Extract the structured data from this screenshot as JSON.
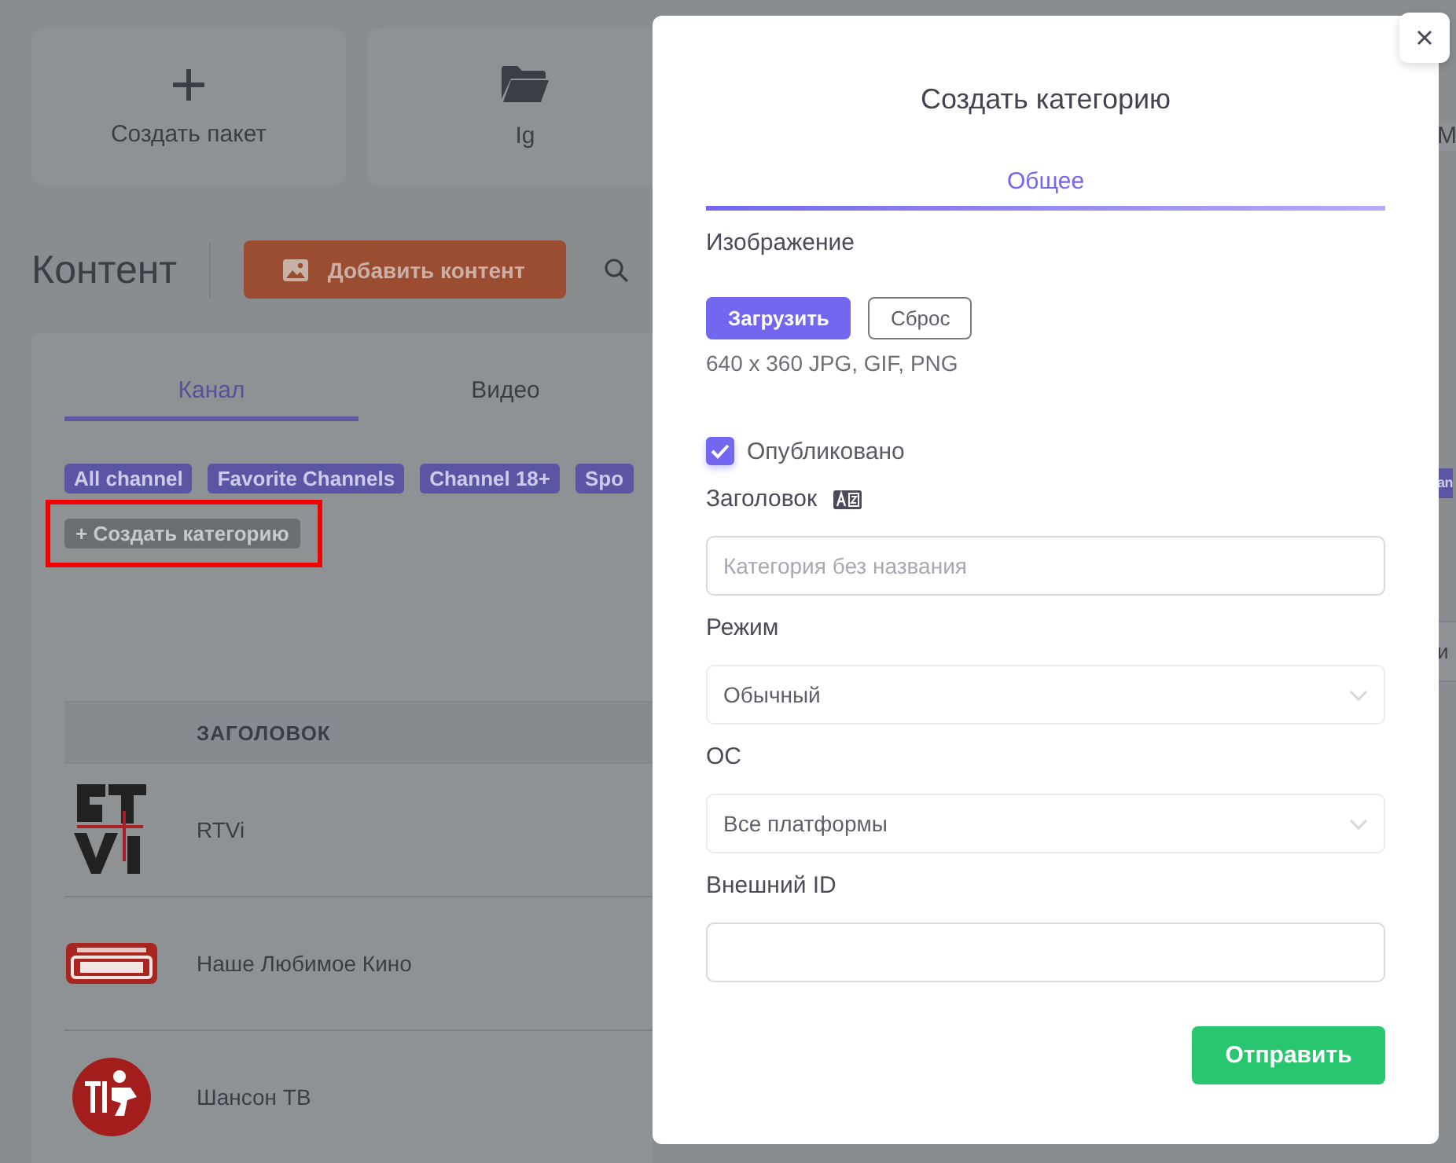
{
  "top_cards": [
    {
      "kind": "plus",
      "label": "Создать пакет"
    },
    {
      "kind": "folder",
      "label": "Ig"
    }
  ],
  "content": {
    "title": "Контент",
    "add_button": "Добавить контент"
  },
  "tabs": [
    {
      "label": "Канал",
      "selected": true
    },
    {
      "label": "Видео",
      "selected": false
    }
  ],
  "category_tags": [
    "All channel",
    "Favorite Channels",
    "Channel 18+",
    "Spo"
  ],
  "create_category_button": {
    "label": "+ Создать категорию",
    "highlighted": true
  },
  "table": {
    "columns": [
      "ЗАГОЛОВОК"
    ],
    "rows": [
      {
        "kind": "rtvi",
        "title": "RTVi"
      },
      {
        "kind": "kino",
        "title": "Наше Любимое Кино"
      },
      {
        "kind": "chanson",
        "title": "Шансон ТВ"
      }
    ]
  },
  "right_edge": {
    "card_label": "M",
    "tag": "an",
    "column_header": "и"
  },
  "modal": {
    "title": "Создать категорию",
    "tabs": [
      {
        "label": "Общее",
        "selected": true
      }
    ],
    "image_label": "Изображение",
    "upload_button": "Загрузить",
    "reset_button": "Сброс",
    "image_hint": "640 x 360 JPG, GIF, PNG",
    "published": {
      "label": "Опубликовано",
      "checked": true
    },
    "fields": [
      {
        "kind": "input",
        "label": "Заголовок",
        "translatable": true,
        "placeholder": "Категория без названия"
      },
      {
        "kind": "select",
        "label": "Режим",
        "value": "Обычный"
      },
      {
        "kind": "select",
        "label": "ОС",
        "value": "Все платформы"
      },
      {
        "kind": "input",
        "label": "Внешний ID"
      }
    ],
    "submit_button": "Отправить"
  }
}
